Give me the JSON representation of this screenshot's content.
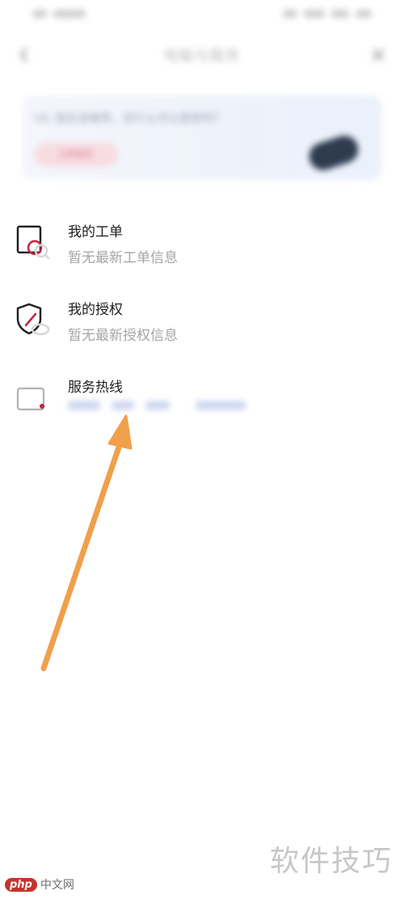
{
  "header": {
    "title": "电脑与服务"
  },
  "banner": {
    "text": "VIL 我应该推荐，您什么可以感觉吗？",
    "button_label": "立即联系"
  },
  "list": [
    {
      "title": "我的工单",
      "subtitle": "暂无最新工单信息",
      "icon": "work-order-icon"
    },
    {
      "title": "我的授权",
      "subtitle": "暂无最新授权信息",
      "icon": "authorization-shield-icon"
    },
    {
      "title": "服务热线",
      "subtitle": "",
      "icon": "service-hotline-icon"
    }
  ],
  "watermark": {
    "right_text": "软件技巧",
    "left_badge": "php",
    "left_text": "中文网"
  },
  "colors": {
    "accent_red": "#c8223f",
    "arrow": "#f0a04b",
    "text_primary": "#1e1e1e",
    "text_secondary": "#a6a6a6"
  }
}
